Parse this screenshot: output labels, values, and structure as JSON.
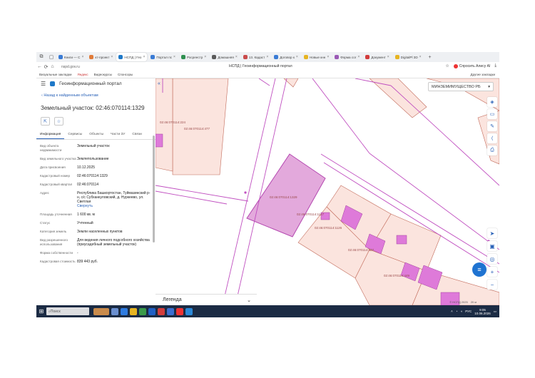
{
  "browser": {
    "tabs": [
      {
        "label": "Книги — С",
        "color": "#3a7bd5"
      },
      {
        "label": "кт-проект",
        "color": "#e07b39"
      },
      {
        "label": "НСПД | Гео",
        "color": "#1e78c8",
        "active": true
      },
      {
        "label": "Портал пс",
        "color": "#3a7bd5"
      },
      {
        "label": "Росреестр",
        "color": "#2f8f4f"
      },
      {
        "label": "Домашняя",
        "color": "#5a5a5a"
      },
      {
        "label": "13. Кадаст",
        "color": "#c94b4b"
      },
      {
        "label": "Договор к",
        "color": "#3a7bd5"
      },
      {
        "label": "Новые кнн",
        "color": "#e6b422"
      },
      {
        "label": "Форма сог",
        "color": "#9a59b5"
      },
      {
        "label": "Документ",
        "color": "#d23c3c"
      },
      {
        "label": "DigitalPl 3D",
        "color": "#e6b422"
      }
    ],
    "url": "nspd.gov.ru",
    "page_title": "НСПД | Геоинформационный портал",
    "alice_label": "Спросить Алису AI",
    "bookmarks": [
      "Визуальные закладки",
      "Яндекс",
      "Видеокурсы",
      "Спонсоры"
    ],
    "other_bookmarks": "Другие закладки"
  },
  "panel": {
    "portal_name": "Геоинформационный портал",
    "back_label": "Назад к найденным объектам",
    "object_title": "Земельный участок: 02:46:070114:1329",
    "tabs": [
      "Информация",
      "Сервисы",
      "Объекты",
      "Части ЗУ",
      "Связи"
    ],
    "properties": [
      {
        "k": "Вид объекта недвижимости",
        "v": "Земельный участок"
      },
      {
        "k": "Вид земельного участка",
        "v": "Землепользование"
      },
      {
        "k": "Дата присвоения",
        "v": "10.12.2025"
      },
      {
        "k": "Кадастровый номер",
        "v": "02:46:070114:1329"
      },
      {
        "k": "Кадастровый квартал",
        "v": "02:46:070114"
      },
      {
        "k": "Адрес",
        "v": "Республика Башкортостан, Туймазинский р-н, с/с Субханкуловский, д. Нуркеево, ул. Светлая",
        "link": "Свернуть"
      },
      {
        "k": "Площадь уточненная",
        "v": "1 600 кв. м"
      },
      {
        "k": "Статус",
        "v": "Учтенный"
      },
      {
        "k": "Категория земель",
        "v": "Земли населенных пунктов"
      },
      {
        "k": "Вид разрешенного использования",
        "v": "Для ведения личного подсобного хозяйства (приусадебный земельный участок)"
      },
      {
        "k": "Форма собственности",
        "v": "-"
      },
      {
        "k": "Кадастровая стоимость",
        "v": "839 443 руб."
      }
    ]
  },
  "map": {
    "layer_select": "МИНЗЕМИМУЩЕСТВО РБ",
    "legend_label": "Легенда",
    "scale_text": "20 м",
    "attrib": "© НСПД 2025",
    "parcels": [
      "02:46:070114:224",
      "02:46:070114:477",
      "02:46:070114:1329",
      "02:46:070114:1127",
      "02:46:070114:1126",
      "02:46:070114:427",
      "02:46:070114:449"
    ],
    "selected_color": "#e3a9dc",
    "parcel_fill": "#fbe4de",
    "boundary_color": "#c04fc0"
  },
  "taskbar": {
    "search_placeholder": "Поиск",
    "lang": "РУС",
    "time": "9:05",
    "date": "10.06.2026"
  }
}
